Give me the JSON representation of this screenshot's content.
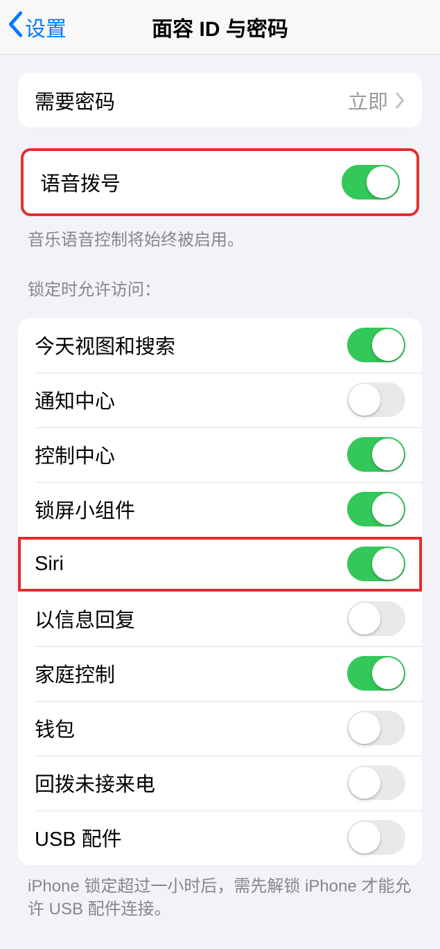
{
  "header": {
    "back_label": "设置",
    "title": "面容 ID 与密码"
  },
  "require_passcode": {
    "label": "需要密码",
    "value": "立即"
  },
  "voice_dial": {
    "label": "语音拨号",
    "on": true,
    "footer": "音乐语音控制将始终被启用。"
  },
  "lock_section": {
    "header": "锁定时允许访问：",
    "items": [
      {
        "label": "今天视图和搜索",
        "on": true
      },
      {
        "label": "通知中心",
        "on": false
      },
      {
        "label": "控制中心",
        "on": true
      },
      {
        "label": "锁屏小组件",
        "on": true
      },
      {
        "label": "Siri",
        "on": true,
        "highlighted": true
      },
      {
        "label": "以信息回复",
        "on": false
      },
      {
        "label": "家庭控制",
        "on": true
      },
      {
        "label": "钱包",
        "on": false
      },
      {
        "label": "回拨未接来电",
        "on": false
      },
      {
        "label": "USB 配件",
        "on": false
      }
    ],
    "footer": "iPhone 锁定超过一小时后，需先解锁 iPhone 才能允许 USB 配件连接。"
  }
}
